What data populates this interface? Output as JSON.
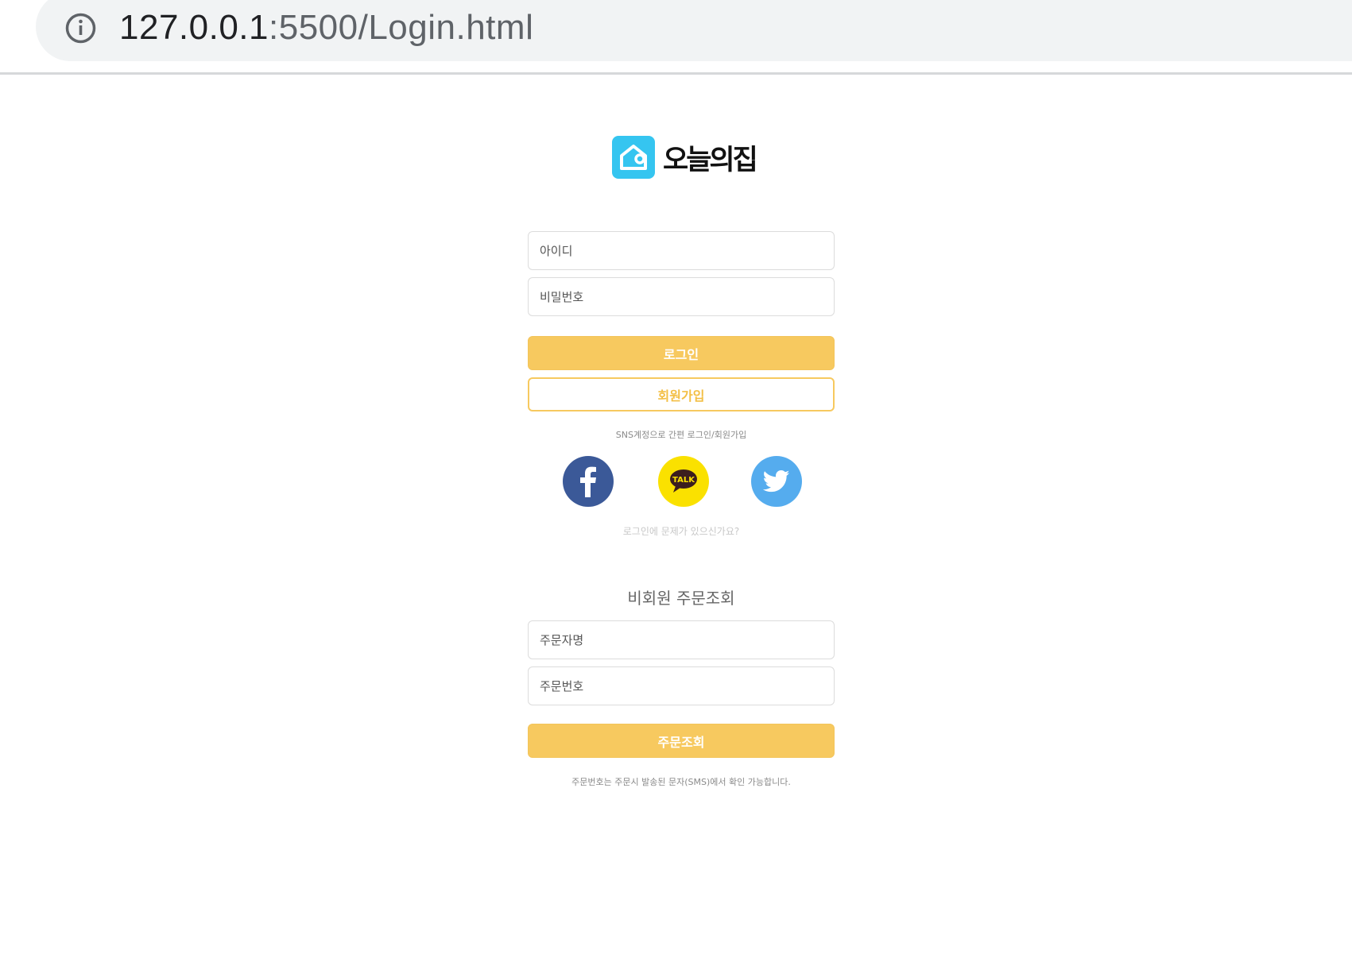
{
  "browser": {
    "url_host": "127.0.0.1",
    "url_path": ":5500/Login.html",
    "info_icon": "info-circle-icon"
  },
  "brand": {
    "name": "오늘의집",
    "logo_icon": "house-logo-icon",
    "logo_color": "#35c5f0"
  },
  "login": {
    "id_placeholder": "아이디",
    "password_placeholder": "비밀번호",
    "login_button": "로그인",
    "signup_button": "회원가입",
    "sns_caption": "SNS계정으로 간편 로그인/회원가입",
    "sns": [
      {
        "name": "facebook",
        "icon": "facebook-icon",
        "color": "#3b5998"
      },
      {
        "name": "kakaotalk",
        "icon": "kakaotalk-icon",
        "color": "#fae100",
        "label": "TALK"
      },
      {
        "name": "twitter",
        "icon": "twitter-icon",
        "color": "#55acee"
      }
    ],
    "trouble_link": "로그인에 문제가 있으신가요?"
  },
  "guest_order": {
    "title": "비회원 주문조회",
    "name_placeholder": "주문자명",
    "order_number_placeholder": "주문번호",
    "lookup_button": "주문조회",
    "note": "주문번호는 주문시 발송된 문자(SMS)에서 확인 가능합니다."
  },
  "colors": {
    "accent": "#f7c95f",
    "accent_text": "#f3bf45"
  }
}
